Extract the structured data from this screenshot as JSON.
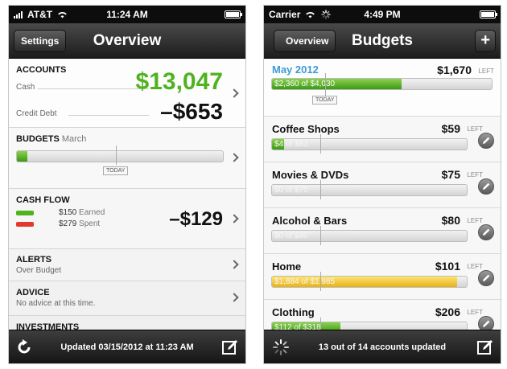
{
  "left": {
    "status": {
      "carrier": "AT&T",
      "time": "11:24 AM"
    },
    "nav": {
      "title": "Overview",
      "button": "Settings"
    },
    "accounts": {
      "heading": "ACCOUNTS",
      "cash_label": "Cash",
      "cash_value": "$13,047",
      "debt_label": "Credit Debt",
      "debt_value": "–$653"
    },
    "budgets": {
      "heading": "BUDGETS",
      "month": "March",
      "today": "TODAY",
      "progress": 0.05
    },
    "cash_flow": {
      "heading": "CASH FLOW",
      "earned_amount": "$150",
      "earned_label": "Earned",
      "spent_amount": "$279",
      "spent_label": "Spent",
      "net": "–$129",
      "earned_color": "#4fb31f",
      "spent_color": "#e2382d"
    },
    "alerts": {
      "heading": "ALERTS",
      "detail": "Over Budget"
    },
    "advice": {
      "heading": "ADVICE",
      "detail": "No advice at this time."
    },
    "investments": {
      "heading": "INVESTMENTS"
    },
    "toolbar": {
      "text": "Updated 03/15/2012 at 11:23 AM",
      "left_icon": "refresh-icon",
      "right_icon": "compose-icon"
    }
  },
  "right": {
    "status": {
      "carrier": "Carrier",
      "time": "4:49 PM"
    },
    "nav": {
      "title": "Budgets",
      "back": "Overview",
      "add": "+"
    },
    "summary": {
      "name": "May 2012",
      "amount": "$1,670",
      "left_label": "LEFT",
      "bar_text": "$2,360 of $4,030",
      "progress": 0.59,
      "today": "TODAY"
    },
    "budgets": [
      {
        "name": "Coffee Shops",
        "amount": "$59",
        "left_label": "LEFT",
        "bar_text": "$4 of $63",
        "progress": 0.06,
        "fill": "green"
      },
      {
        "name": "Movies & DVDs",
        "amount": "$75",
        "left_label": "LEFT",
        "bar_text": "$0 of $75",
        "progress": 0,
        "fill": "green"
      },
      {
        "name": "Alcohol & Bars",
        "amount": "$80",
        "left_label": "LEFT",
        "bar_text": "$0 of $80",
        "progress": 0,
        "fill": "green"
      },
      {
        "name": "Home",
        "amount": "$101",
        "left_label": "LEFT",
        "bar_text": "$1,884 of $1,985",
        "progress": 0.95,
        "fill": "yellow"
      },
      {
        "name": "Clothing",
        "amount": "$206",
        "left_label": "LEFT",
        "bar_text": "$112 of $318",
        "progress": 0.35,
        "fill": "green"
      }
    ],
    "toolbar": {
      "text": "13 out of 14 accounts updated",
      "left_icon": "spinner-icon",
      "right_icon": "compose-icon"
    }
  }
}
